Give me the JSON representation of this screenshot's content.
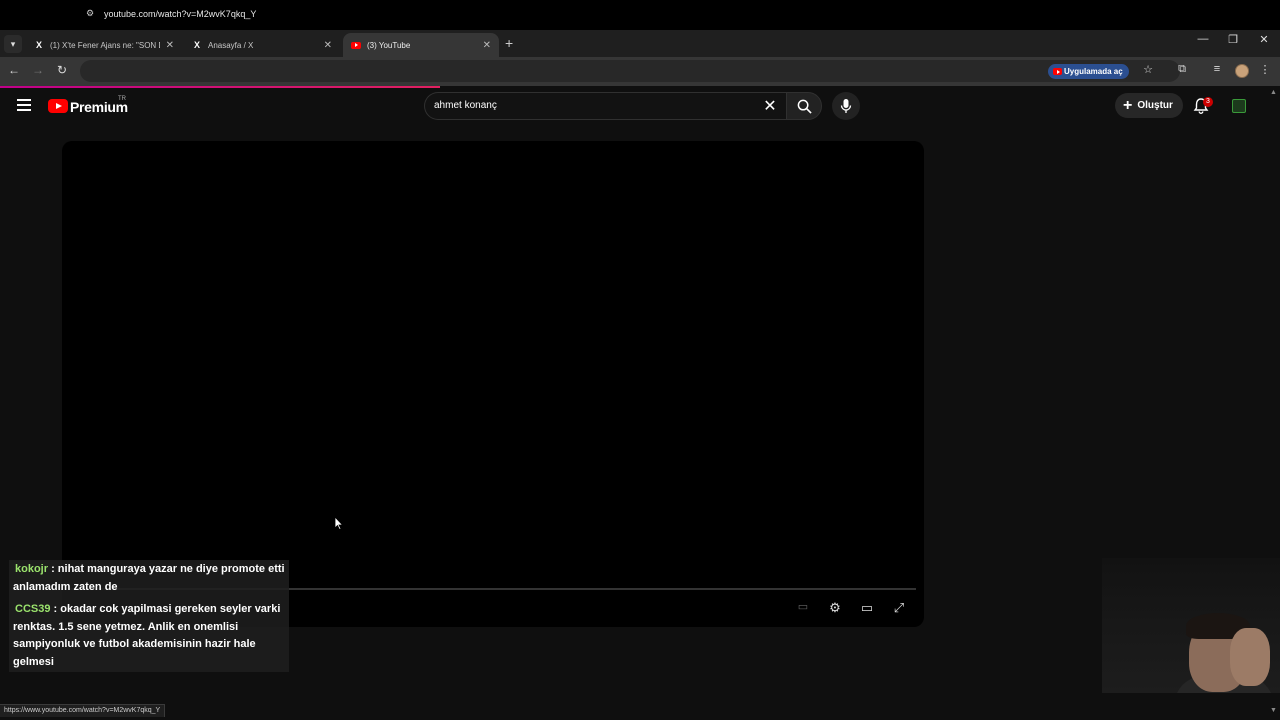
{
  "browser": {
    "tabs": [
      {
        "title": "(1) X'te Fener Ajans ne: \"SON D...",
        "favicon": "x-logo-icon",
        "active": false
      },
      {
        "title": "Anasayfa / X",
        "favicon": "x-logo-icon",
        "active": false
      },
      {
        "title": "(3) YouTube",
        "favicon": "youtube-icon",
        "active": true
      }
    ],
    "new_tab_symbol": "+",
    "url": "youtube.com/watch?v=M2wvK7qkq_Y",
    "open_in_app_label": "Uygulamada aç",
    "status_url": "https://www.youtube.com/watch?v=M2wvK7qkq_Y"
  },
  "youtube": {
    "brand": "Premium",
    "region": "TR",
    "search_query": "ahmet konanç",
    "create_label": "Oluştur",
    "notification_count": "3",
    "accent_color": "#ff0000"
  },
  "chat": {
    "messages": [
      {
        "user": "kokojr",
        "separator": " : ",
        "text": "nihat manguraya yazar ne diye promote etti anlamadım zaten de"
      },
      {
        "user": "CCS39",
        "separator": " : ",
        "text": "okadar cok yapilmasi gereken seyler varki renktas. 1.5 sene yetmez. Anlik en onemlisi sampiyonluk ve futbol akademisinin hazir hale gelmesi"
      }
    ],
    "username_color": "#9be36d"
  }
}
